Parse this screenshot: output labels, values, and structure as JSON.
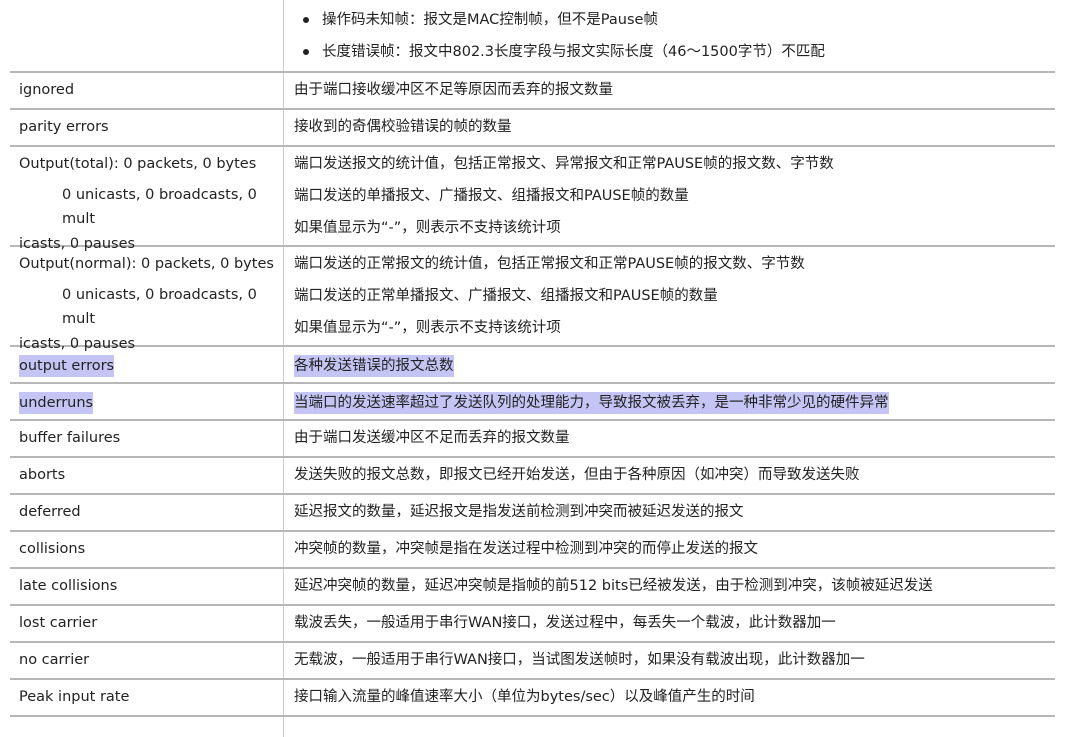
{
  "top_bullets": [
    "操作码未知帧：报文是MAC控制帧，但不是Pause帧",
    "长度错误帧：报文中802.3长度字段与报文实际长度（46～1500字节）不匹配"
  ],
  "rows": [
    {
      "field": "ignored",
      "desc": [
        "由于端口接收缓冲区不足等原因而丢弃的报文数量"
      ]
    },
    {
      "field": "parity errors",
      "desc": [
        "接收到的奇偶校验错误的帧的数量"
      ]
    },
    {
      "field_lines": [
        "Output(total): 0 packets, 0 bytes",
        "0 unicasts, 0 broadcasts, 0 mult",
        "icasts, 0 pauses"
      ],
      "desc": [
        "端口发送报文的统计值，包括正常报文、异常报文和正常PAUSE帧的报文数、字节数",
        "端口发送的单播报文、广播报文、组播报文和PAUSE帧的数量",
        "如果值显示为“-”，则表示不支持该统计项"
      ]
    },
    {
      "field_lines": [
        "Output(normal): 0 packets, 0 bytes",
        "0 unicasts, 0 broadcasts, 0 mult",
        "icasts, 0 pauses"
      ],
      "desc": [
        "端口发送的正常报文的统计值，包括正常报文和正常PAUSE帧的报文数、字节数",
        "端口发送的正常单播报文、广播报文、组播报文和PAUSE帧的数量",
        "如果值显示为“-”，则表示不支持该统计项"
      ]
    },
    {
      "field": "output errors",
      "desc": [
        "各种发送错误的报文总数"
      ]
    },
    {
      "field": "underruns",
      "desc": [
        "当端口的发送速率超过了发送队列的处理能力，导致报文被丢弃，是一种非常少见的硬件异常"
      ]
    },
    {
      "field": "buffer failures",
      "desc": [
        "由于端口发送缓冲区不足而丢弃的报文数量"
      ]
    },
    {
      "field": "aborts",
      "desc": [
        "发送失败的报文总数，即报文已经开始发送，但由于各种原因（如冲突）而导致发送失败"
      ]
    },
    {
      "field": "deferred",
      "desc": [
        "延迟报文的数量，延迟报文是指发送前检测到冲突而被延迟发送的报文"
      ]
    },
    {
      "field": "collisions",
      "desc": [
        "冲突帧的数量，冲突帧是指在发送过程中检测到冲突的而停止发送的报文"
      ]
    },
    {
      "field": "late collisions",
      "desc": [
        "延迟冲突帧的数量，延迟冲突帧是指帧的前512 bits已经被发送，由于检测到冲突，该帧被延迟发送"
      ]
    },
    {
      "field": "lost carrier",
      "desc": [
        "载波丢失，一般适用于串行WAN接口，发送过程中，每丢失一个载波，此计数器加一"
      ]
    },
    {
      "field": "no carrier",
      "desc": [
        "无载波，一般适用于串行WAN接口，当试图发送帧时，如果没有载波出现，此计数器加一"
      ]
    },
    {
      "field": "Peak input rate",
      "desc": [
        "接口输入流量的峰值速率大小（单位为bytes/sec）以及峰值产生的时间"
      ]
    }
  ],
  "highlight_color": "#c5c5f5"
}
